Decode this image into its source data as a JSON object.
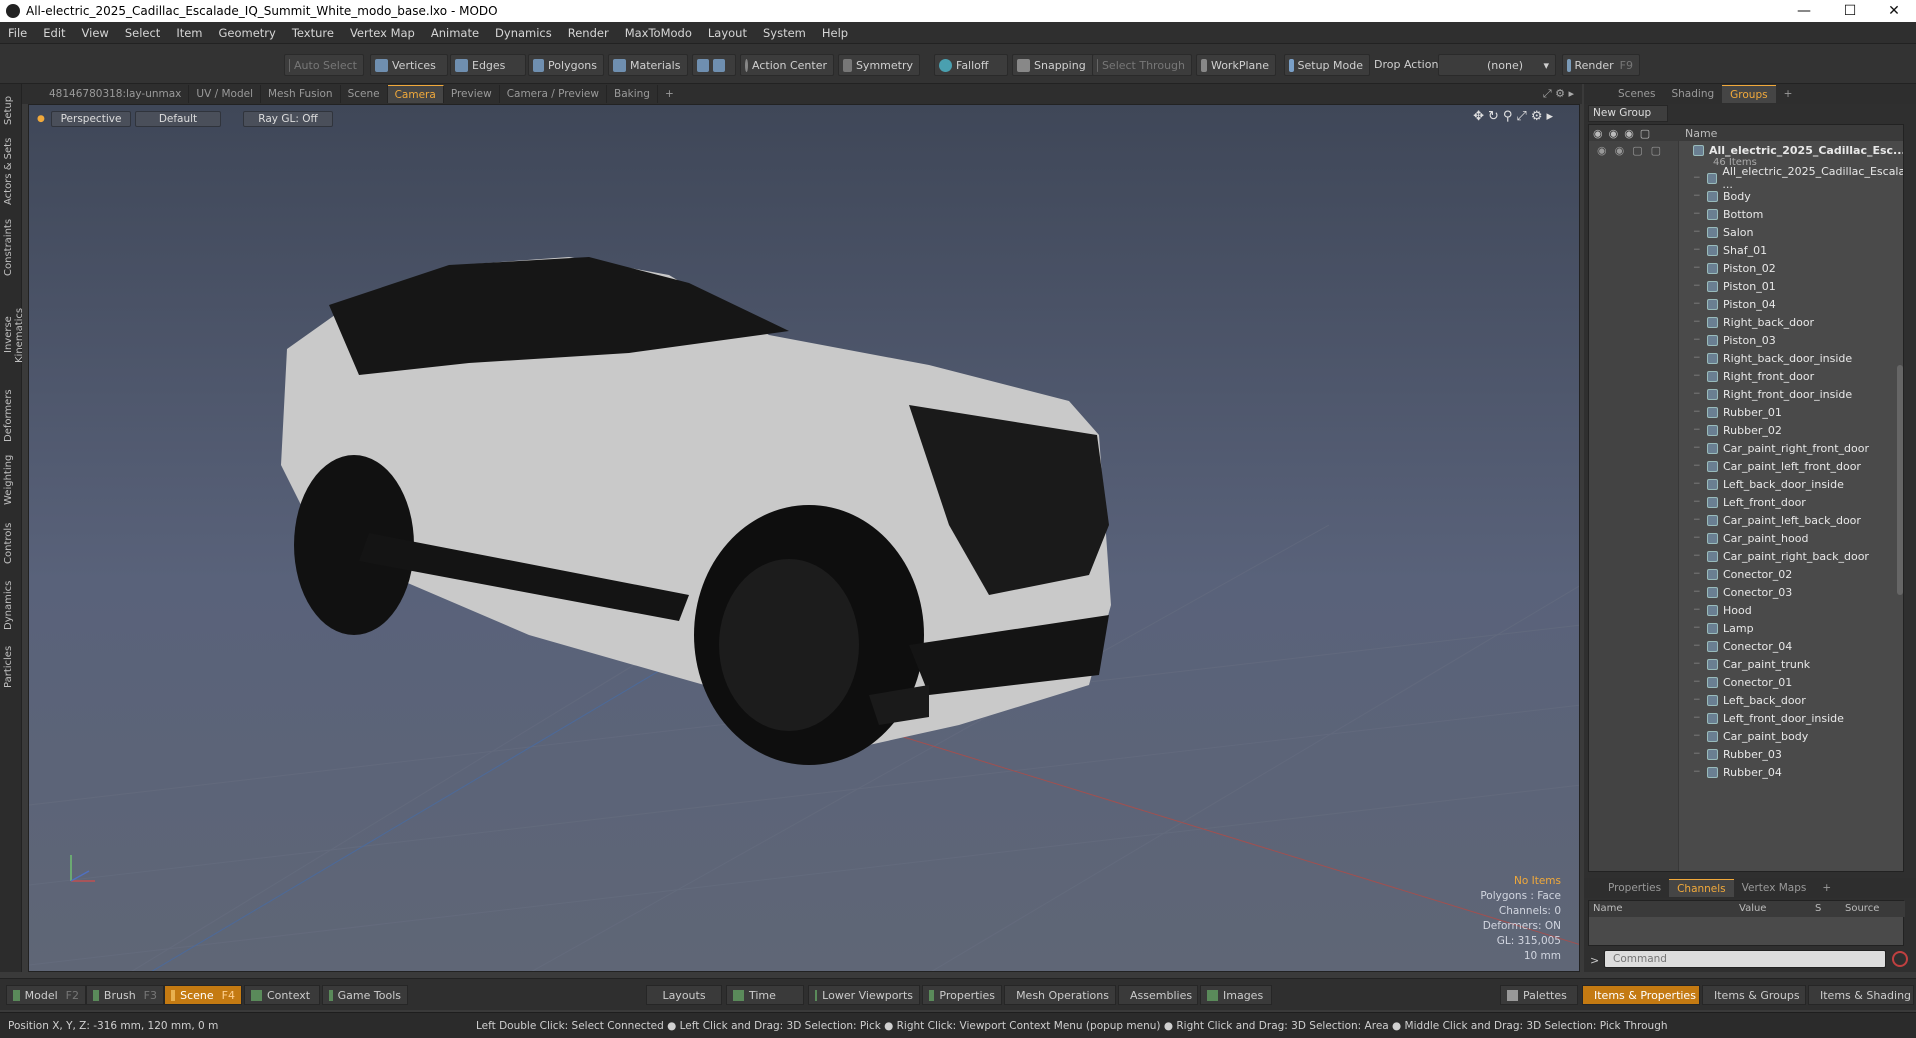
{
  "title": "All-electric_2025_Cadillac_Escalade_IQ_Summit_White_modo_base.lxo - MODO",
  "menu": [
    "File",
    "Edit",
    "View",
    "Select",
    "Item",
    "Geometry",
    "Texture",
    "Vertex Map",
    "Animate",
    "Dynamics",
    "Render",
    "MaxToModo",
    "Layout",
    "System",
    "Help"
  ],
  "toolbar": {
    "auto_select": "Auto Select",
    "vertices": "Vertices",
    "edges": "Edges",
    "polygons": "Polygons",
    "materials": "Materials",
    "action_center": "Action Center",
    "symmetry": "Symmetry",
    "falloff": "Falloff",
    "snapping": "Snapping",
    "select_through": "Select Through",
    "workplane": "WorkPlane",
    "setup_mode": "Setup Mode",
    "drop_action": "Drop Action",
    "drop_value": "(none)",
    "render": "Render",
    "render_key": "F9"
  },
  "left_tabs": [
    "Setup",
    "Actors & Sets",
    "Constraints",
    "Inverse Kinematics",
    "Deformers",
    "Weighting",
    "Controls",
    "Dynamics",
    "Particles"
  ],
  "viewport_tabs": [
    {
      "label": "48146780318:lay-unmax",
      "active": false
    },
    {
      "label": "UV / Model",
      "active": false
    },
    {
      "label": "Mesh Fusion",
      "active": false
    },
    {
      "label": "Scene",
      "active": false
    },
    {
      "label": "Camera",
      "active": true
    },
    {
      "label": "Preview",
      "active": false
    },
    {
      "label": "Camera / Preview",
      "active": false
    },
    {
      "label": "Baking",
      "active": false
    },
    {
      "label": "+",
      "active": false
    }
  ],
  "viewport": {
    "view": "Perspective",
    "shading": "Default",
    "raygl": "Ray GL: Off",
    "info": {
      "items": "No Items",
      "polygons": "Polygons : Face",
      "channels": "Channels: 0",
      "deformers": "Deformers: ON",
      "gl": "GL: 315,005",
      "scale": "10 mm"
    }
  },
  "right_tabs": [
    {
      "label": "Scenes",
      "active": false
    },
    {
      "label": "Shading",
      "active": false
    },
    {
      "label": "Groups",
      "active": true
    },
    {
      "label": "+",
      "active": false
    }
  ],
  "groups": {
    "new_group": "New Group",
    "name_header": "Name",
    "root": "All_electric_2025_Cadillac_Esc...",
    "root_count": "46 Items",
    "items": [
      "All_electric_2025_Cadillac_Escala ...",
      "Body",
      "Bottom",
      "Salon",
      "Shaf_01",
      "Piston_02",
      "Piston_01",
      "Piston_04",
      "Right_back_door",
      "Piston_03",
      "Right_back_door_inside",
      "Right_front_door",
      "Right_front_door_inside",
      "Rubber_01",
      "Rubber_02",
      "Car_paint_right_front_door",
      "Car_paint_left_front_door",
      "Left_back_door_inside",
      "Left_front_door",
      "Car_paint_left_back_door",
      "Car_paint_hood",
      "Car_paint_right_back_door",
      "Conector_02",
      "Conector_03",
      "Hood",
      "Lamp",
      "Conector_04",
      "Car_paint_trunk",
      "Conector_01",
      "Left_back_door",
      "Left_front_door_inside",
      "Car_paint_body",
      "Rubber_03",
      "Rubber_04"
    ]
  },
  "prop_tabs": [
    {
      "label": "Properties",
      "active": false
    },
    {
      "label": "Channels",
      "active": true
    },
    {
      "label": "Vertex Maps",
      "active": false
    },
    {
      "label": "+",
      "active": false
    }
  ],
  "channels": {
    "name": "Name",
    "value": "Value",
    "s": "S",
    "source": "Source"
  },
  "command": {
    "prompt": ">",
    "placeholder": "Command"
  },
  "bottom": {
    "model": "Model",
    "model_key": "F2",
    "brush": "Brush",
    "brush_key": "F3",
    "scene": "Scene",
    "scene_key": "F4",
    "context": "Context",
    "game_tools": "Game Tools",
    "layouts": "Layouts",
    "time": "Time",
    "lower_viewports": "Lower Viewports",
    "properties": "Properties",
    "mesh_operations": "Mesh Operations",
    "assemblies": "Assemblies",
    "images": "Images",
    "palettes": "Palettes",
    "items_properties": "Items & Properties",
    "items_groups": "Items & Groups",
    "items_shading": "Items & Shading"
  },
  "status": {
    "position": "Position X, Y, Z:  -316 mm, 120 mm, 0 m",
    "hints": "Left Double Click: Select Connected ● Left Click and Drag: 3D Selection: Pick ● Right Click: Viewport Context Menu (popup menu) ● Right Click and Drag: 3D Selection: Area ● Middle Click and Drag: 3D Selection: Pick Through"
  }
}
